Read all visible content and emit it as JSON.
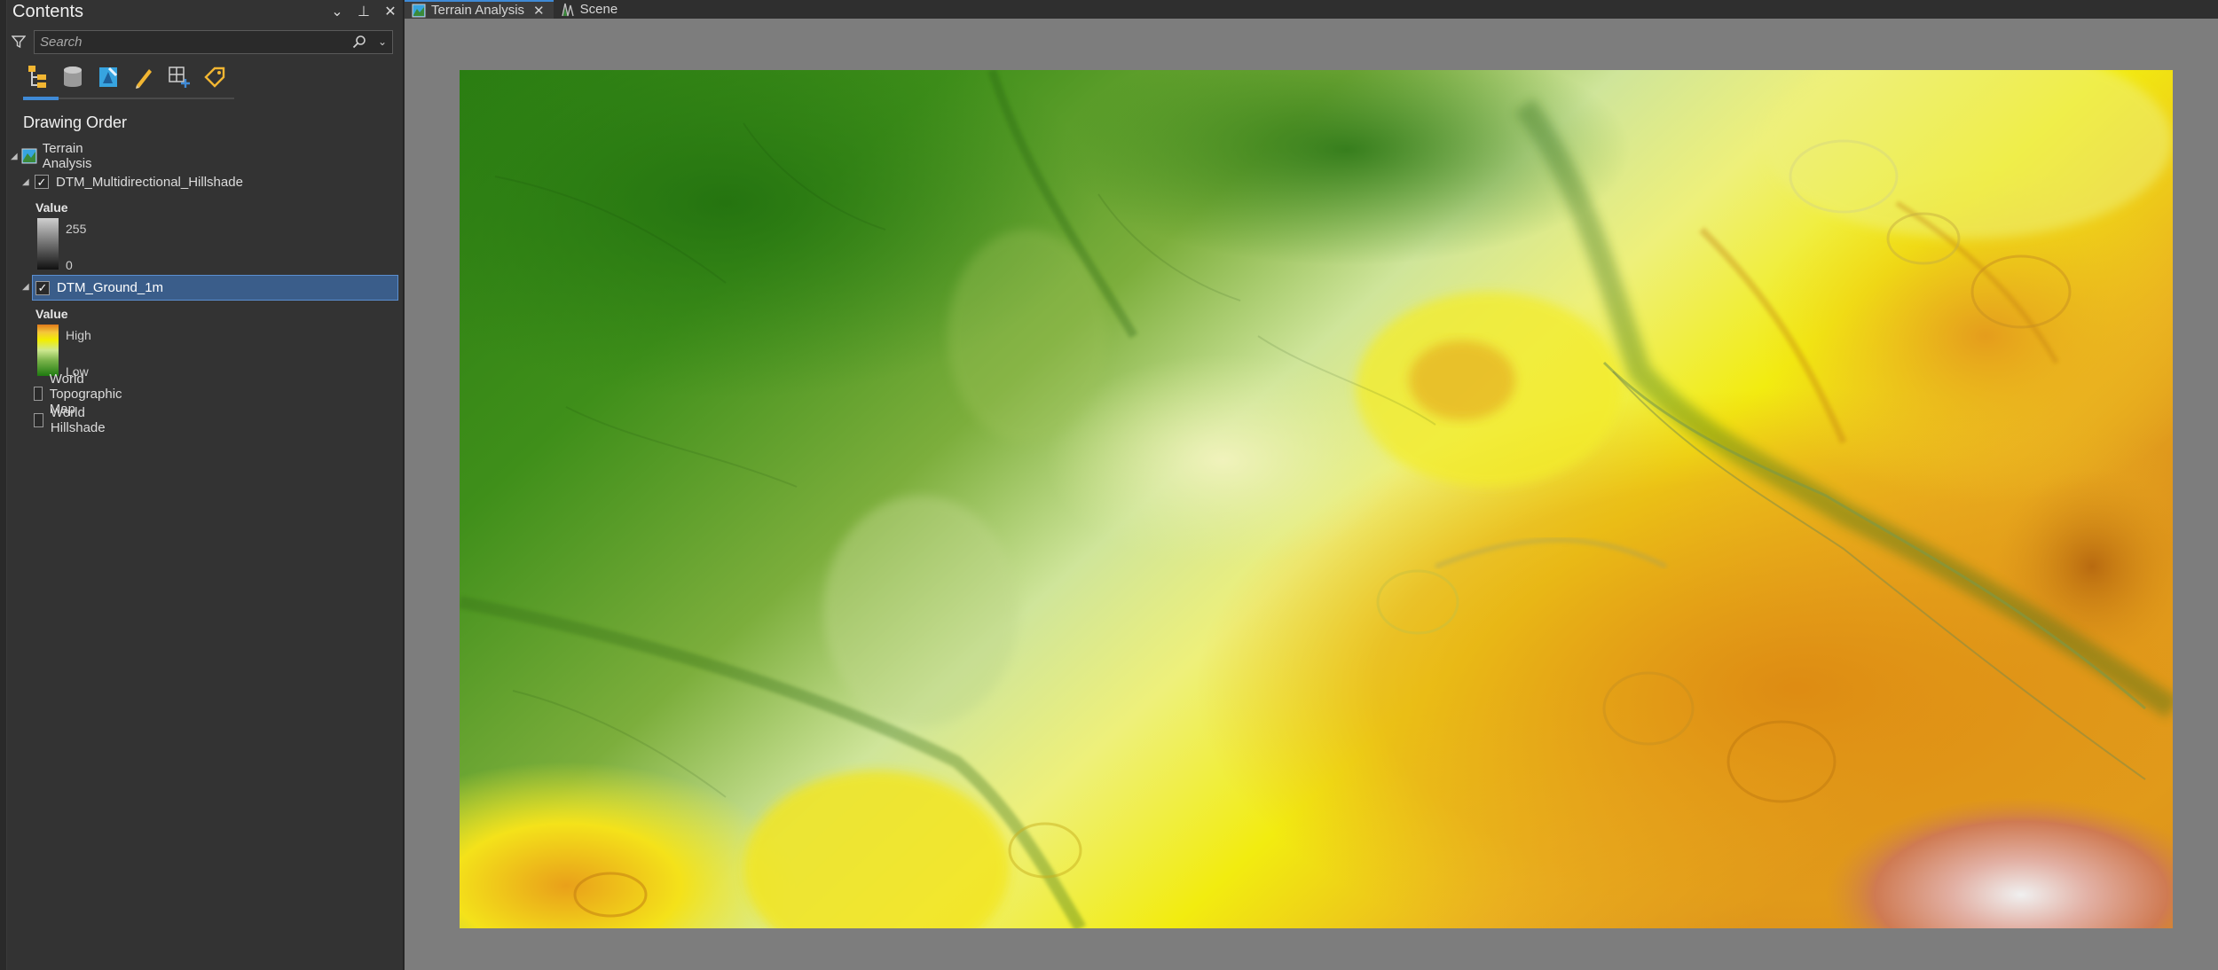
{
  "contents": {
    "title": "Contents",
    "search_placeholder": "Search",
    "section_title": "Drawing Order",
    "map_name": "Terrain Analysis",
    "layers": [
      {
        "name": "DTM_Multidirectional_Hillshade",
        "checked": true,
        "legend_title": "Value",
        "max_label": "255",
        "min_label": "0"
      },
      {
        "name": "DTM_Ground_1m",
        "checked": true,
        "selected": true,
        "legend_title": "Value",
        "max_label": "High",
        "min_label": "Low"
      },
      {
        "name": "World Topographic Map",
        "checked": false
      },
      {
        "name": "World Hillshade",
        "checked": false
      }
    ]
  },
  "tabs": [
    {
      "label": "Terrain Analysis",
      "active": true
    },
    {
      "label": "Scene",
      "active": false
    }
  ],
  "colors": {
    "accent": "#3f8ad6",
    "ramp_high": "#e07a1a",
    "ramp_mid": "#f2ee00",
    "ramp_low": "#1f7a10"
  }
}
